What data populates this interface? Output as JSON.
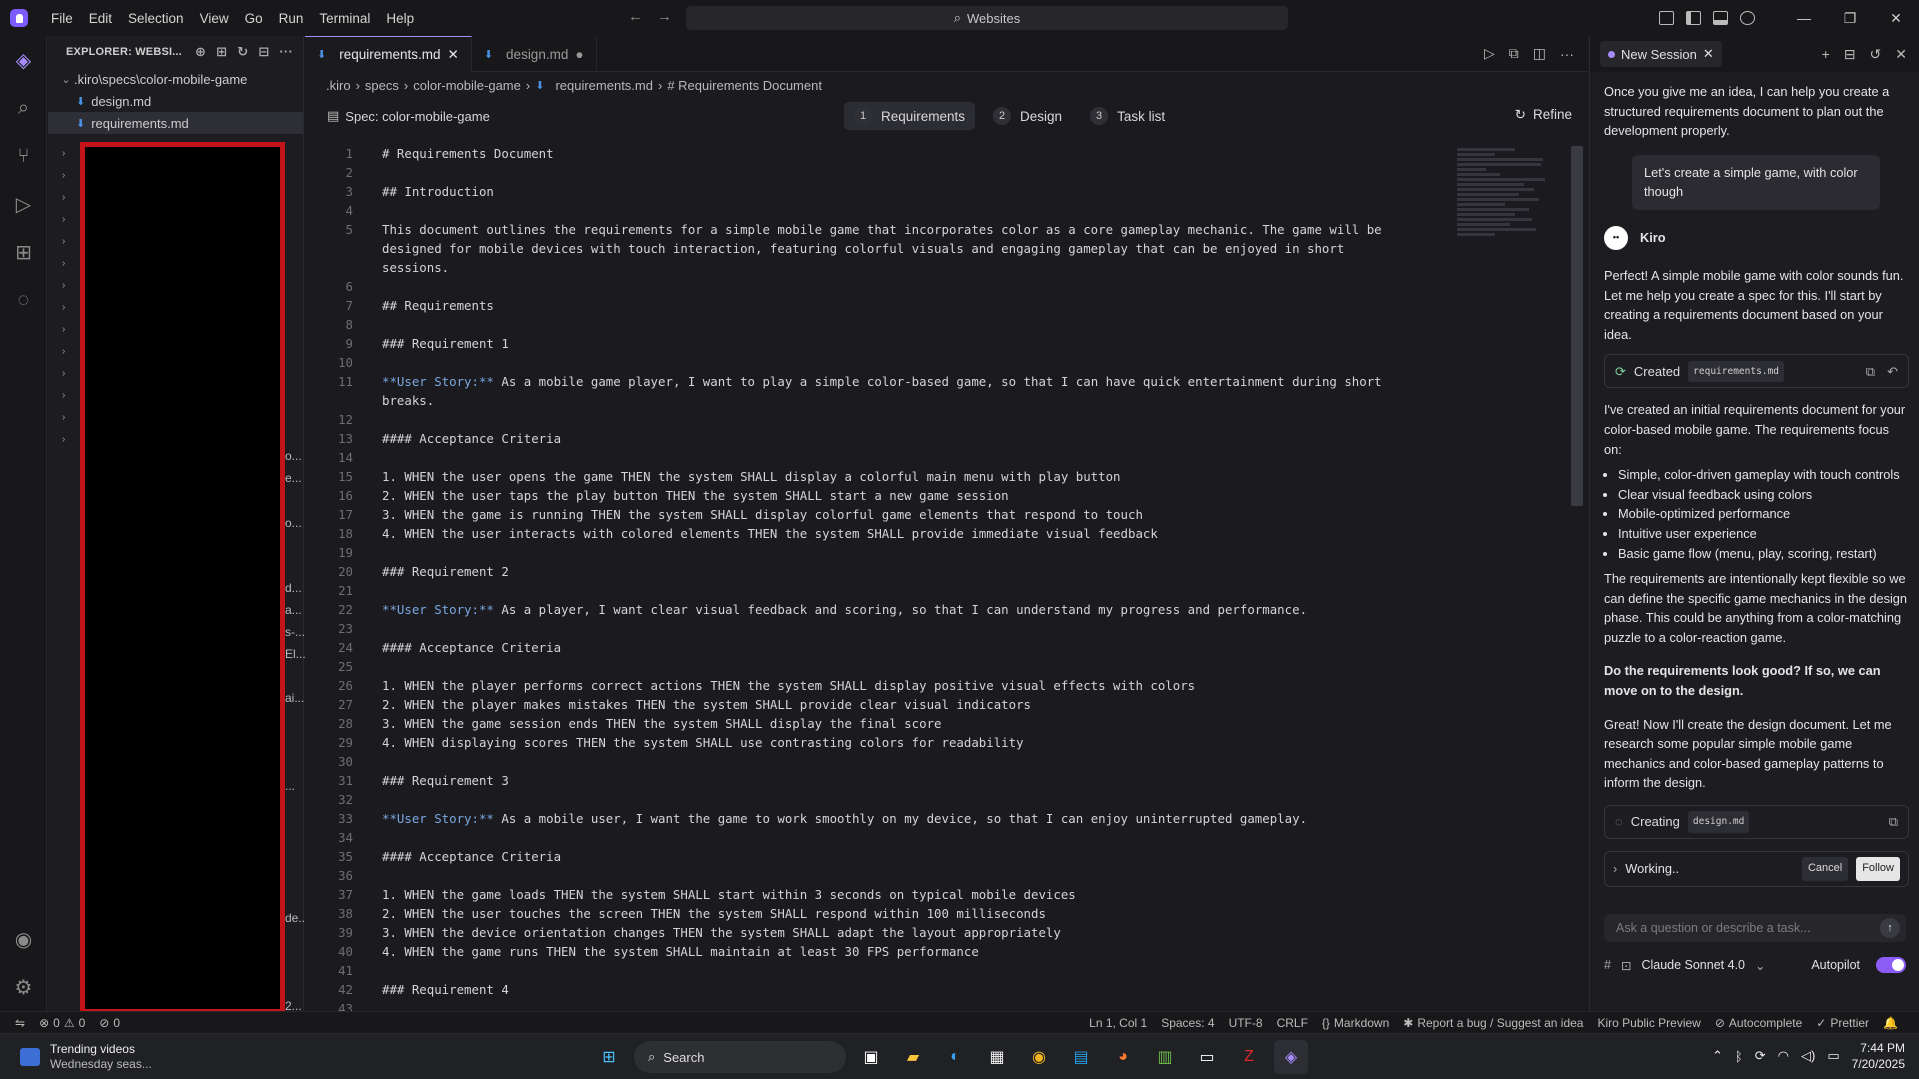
{
  "menu": [
    "File",
    "Edit",
    "Selection",
    "View",
    "Go",
    "Run",
    "Terminal",
    "Help"
  ],
  "command_center": "Websites",
  "explorer": {
    "title": "EXPLORER: WEBSI...",
    "root": ".kiro\\specs\\color-mobile-game",
    "files": [
      "design.md",
      "requirements.md"
    ],
    "peek": [
      "o...",
      "e...",
      "o...",
      "d...",
      "a...",
      "s-...",
      "El...",
      "ai...",
      "...",
      "de...",
      "2..."
    ]
  },
  "tabs": [
    {
      "label": "requirements.md",
      "state": "active"
    },
    {
      "label": "design.md",
      "state": "modified"
    }
  ],
  "breadcrumb": [
    ".kiro",
    "specs",
    "color-mobile-game",
    "requirements.md",
    "# Requirements Document"
  ],
  "spec": {
    "title": "Spec: color-mobile-game",
    "steps": [
      {
        "num": "1",
        "label": "Requirements"
      },
      {
        "num": "2",
        "label": "Design"
      },
      {
        "num": "3",
        "label": "Task list"
      }
    ],
    "refine": "Refine"
  },
  "code_lines": [
    "# Requirements Document",
    "",
    "## Introduction",
    "",
    "This document outlines the requirements for a simple mobile game that incorporates color as a core gameplay mechanic. The game will be",
    "designed for mobile devices with touch interaction, featuring colorful visuals and engaging gameplay that can be enjoyed in short",
    "sessions.",
    "",
    "## Requirements",
    "",
    "### Requirement 1",
    "",
    "**User Story:** As a mobile game player, I want to play a simple color-based game, so that I can have quick entertainment during short",
    "breaks.",
    "",
    "#### Acceptance Criteria",
    "",
    "1. WHEN the user opens the game THEN the system SHALL display a colorful main menu with play button",
    "2. WHEN the user taps the play button THEN the system SHALL start a new game session",
    "3. WHEN the game is running THEN the system SHALL display colorful game elements that respond to touch",
    "4. WHEN the user interacts with colored elements THEN the system SHALL provide immediate visual feedback",
    "",
    "### Requirement 2",
    "",
    "**User Story:** As a player, I want clear visual feedback and scoring, so that I can understand my progress and performance.",
    "",
    "#### Acceptance Criteria",
    "",
    "1. WHEN the player performs correct actions THEN the system SHALL display positive visual effects with colors",
    "2. WHEN the player makes mistakes THEN the system SHALL provide clear visual indicators",
    "3. WHEN the game session ends THEN the system SHALL display the final score",
    "4. WHEN displaying scores THEN the system SHALL use contrasting colors for readability",
    "",
    "### Requirement 3",
    "",
    "**User Story:** As a mobile user, I want the game to work smoothly on my device, so that I can enjoy uninterrupted gameplay.",
    "",
    "#### Acceptance Criteria",
    "",
    "1. WHEN the game loads THEN the system SHALL start within 3 seconds on typical mobile devices",
    "2. WHEN the user touches the screen THEN the system SHALL respond within 100 milliseconds",
    "3. WHEN the device orientation changes THEN the system SHALL adapt the layout appropriately",
    "4. WHEN the game runs THEN the system SHALL maintain at least 30 FPS performance",
    "",
    "### Requirement 4",
    ""
  ],
  "line_numbers": [
    "1",
    "2",
    "3",
    "4",
    "5",
    "",
    "",
    "6",
    "7",
    "8",
    "9",
    "10",
    "11",
    "",
    "12",
    "13",
    "14",
    "15",
    "16",
    "17",
    "18",
    "19",
    "20",
    "21",
    "22",
    "23",
    "24",
    "25",
    "26",
    "27",
    "28",
    "29",
    "30",
    "31",
    "32",
    "33",
    "34",
    "35",
    "36",
    "37",
    "38",
    "39",
    "40",
    "41",
    "42",
    "43"
  ],
  "chat": {
    "tab": "New Session",
    "intro": "Once you give me an idea, I can help you create a structured requirements document to plan out the development properly.",
    "user_msg": "Let's create a simple game, with color though",
    "agent_name": "Kiro",
    "msg1": "Perfect! A simple mobile game with color sounds fun. Let me help you create a spec for this. I'll start by creating a requirements document based on your idea.",
    "created_label": "Created",
    "created_file": "requirements.md",
    "msg2": "I've created an initial requirements document for your color-based mobile game. The requirements focus on:",
    "bullets": [
      "Simple, color-driven gameplay with touch controls",
      "Clear visual feedback using colors",
      "Mobile-optimized performance",
      "Intuitive user experience",
      "Basic game flow (menu, play, scoring, restart)"
    ],
    "msg3": "The requirements are intentionally kept flexible so we can define the specific game mechanics in the design phase. This could be anything from a color-matching puzzle to a color-reaction game.",
    "question": "Do the requirements look good? If so, we can move on to the design.",
    "msg4": "Great! Now I'll create the design document. Let me research some popular simple mobile game mechanics and color-based gameplay patterns to inform the design.",
    "creating_label": "Creating",
    "creating_file": "design.md",
    "working": "Working..",
    "cancel": "Cancel",
    "follow": "Follow",
    "input_placeholder": "Ask a question or describe a task...",
    "model": "Claude Sonnet 4.0",
    "autopilot": "Autopilot"
  },
  "statusbar": {
    "errors": "0",
    "warnings": "0",
    "ports": "0",
    "position": "Ln 1, Col 1",
    "spaces": "Spaces: 4",
    "encoding": "UTF-8",
    "eol": "CRLF",
    "language": "Markdown",
    "report": "Report a bug / Suggest an idea",
    "preview": "Kiro Public Preview",
    "autocomplete": "Autocomplete",
    "prettier": "Prettier"
  },
  "taskbar": {
    "widget_title": "Trending videos",
    "widget_sub": "Wednesday seas...",
    "search": "Search",
    "time": "7:44 PM",
    "date": "7/20/2025"
  },
  "colors": {
    "accent": "#a78bfa",
    "toggle": "#8b5cf6",
    "redaction_border": "#c4141a"
  }
}
